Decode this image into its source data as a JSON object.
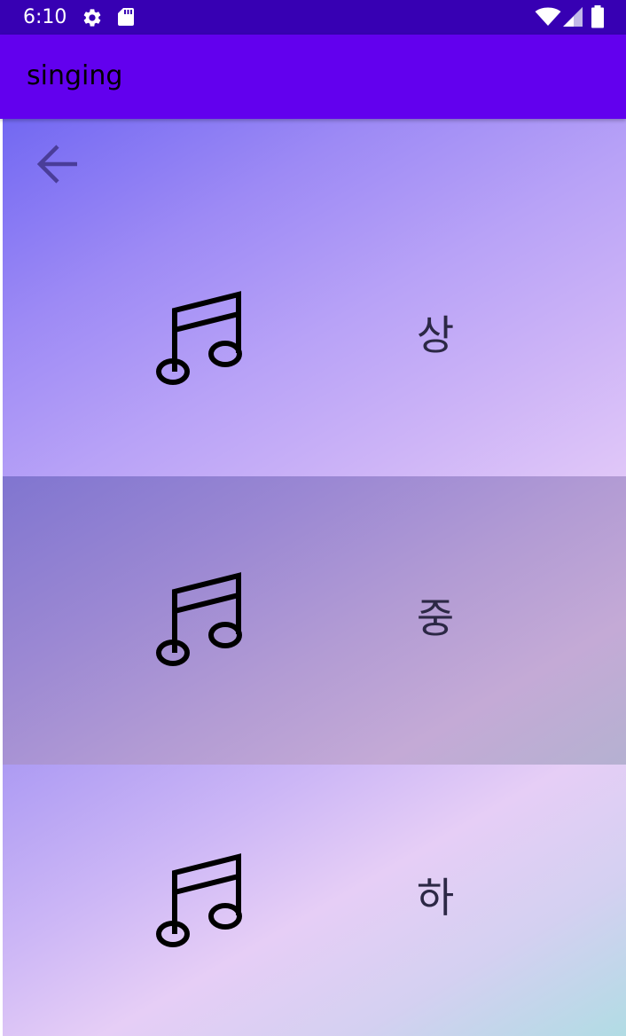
{
  "status_bar": {
    "time": "6:10",
    "icons": [
      "gear-icon",
      "sd-card-icon",
      "wifi-icon",
      "cell-signal-icon",
      "battery-icon"
    ]
  },
  "app_bar": {
    "title": "singing"
  },
  "navigation": {
    "back_icon": "arrow-back-icon"
  },
  "levels": [
    {
      "label": "상",
      "icon": "music-note-icon"
    },
    {
      "label": "중",
      "icon": "music-note-icon"
    },
    {
      "label": "하",
      "icon": "music-note-icon"
    }
  ],
  "colors": {
    "status_bar": "#3700b3",
    "app_bar": "#6200ee",
    "label_text": "#2c2845",
    "back_arrow": "#4a3d99"
  }
}
